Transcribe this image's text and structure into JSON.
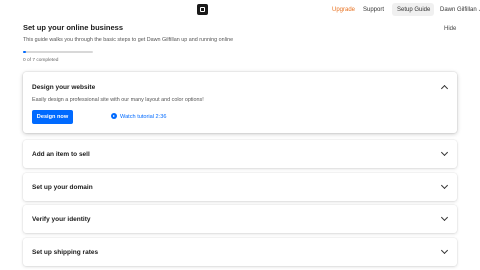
{
  "header": {
    "upgrade_label": "Upgrade",
    "support_label": "Support",
    "setup_guide_label": "Setup Guide",
    "user_name": "Dawn Gilfillan",
    "user_chevron": "⌄"
  },
  "guide": {
    "title": "Set up your online business",
    "subtitle": "This guide walks you through the basic steps to get Dawn Gilfillan up and running online",
    "hide_label": "Hide",
    "progress_text": "0 of 7 completed",
    "progress_fraction": 0.04
  },
  "expanded_step": {
    "title": "Design your website",
    "description": "Easily design a professional site with our many layout and color options!",
    "primary_button": "Design now",
    "tutorial_link": "Watch tutorial 2:36"
  },
  "steps": [
    {
      "title": "Add an item to sell"
    },
    {
      "title": "Set up your domain"
    },
    {
      "title": "Verify your identity"
    },
    {
      "title": "Set up shipping rates"
    }
  ],
  "colors": {
    "accent": "#006aff",
    "upgrade": "#e8711f"
  }
}
